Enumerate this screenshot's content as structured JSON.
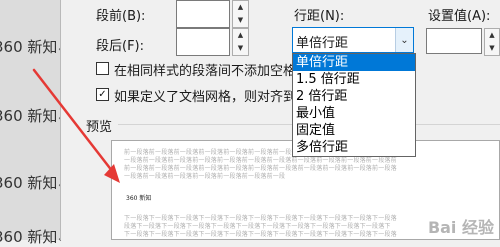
{
  "document": {
    "lines": [
      "360 新知",
      "360 新知",
      "360 新知",
      "360 新知"
    ],
    "para_mark": "↵"
  },
  "spacing": {
    "before_label": "段前(B):",
    "after_label": "段后(F):",
    "line_spacing_label": "行距(N):",
    "set_value_label": "设置值(A):",
    "before_value": "",
    "after_value": "",
    "set_value": "",
    "line_spacing_value": "单倍行距",
    "line_spacing_options": [
      "单倍行距",
      "1.5 倍行距",
      "2 倍行距",
      "最小值",
      "固定值",
      "多倍行距"
    ]
  },
  "checkboxes": {
    "no_space_same_style": {
      "label": "在相同样式的段落间不添加空格(",
      "checked": false
    },
    "snap_to_grid": {
      "label": "如果定义了文档网格，则对齐到网",
      "checked": true,
      "check_glyph": "✓"
    }
  },
  "preview": {
    "title": "预览",
    "prev_line_1": "前一段落前一段落前一段落前一段落前一段落前一段落前一段落前一段落前一段落前一段落前一段落",
    "prev_line_2": "一段落前一段落前一段落前一段落前一段落前一段落前一段落前一段落前一段落前一段落前一段落前",
    "prev_line_3": "前一段落前一段落前一段落前一段落前一段落前一段落前一段落前一段落前一段落前一段落前一段落",
    "prev_line_4": "一段落前一段落前一段落前一段落前一段落前一段落前一段",
    "sample_text": "360 新知",
    "next_line_1": "下一段落下一段落下一段落下一段落下一段落下一段落下一段落下一段落下一段落下一段落下一段落",
    "next_line_2": "段落下一段落下一段落下一段落下一段落下一段落下一段落下一段落下一段落下一段落下一段落下",
    "next_line_3": "下一段落下一段落下一段落下一段落下一段落下一段落下一段落下一段落下一段落下一段落下一段落"
  },
  "watermark": "Bai 经验",
  "annotation": {
    "arrow_color": "#e53935"
  }
}
